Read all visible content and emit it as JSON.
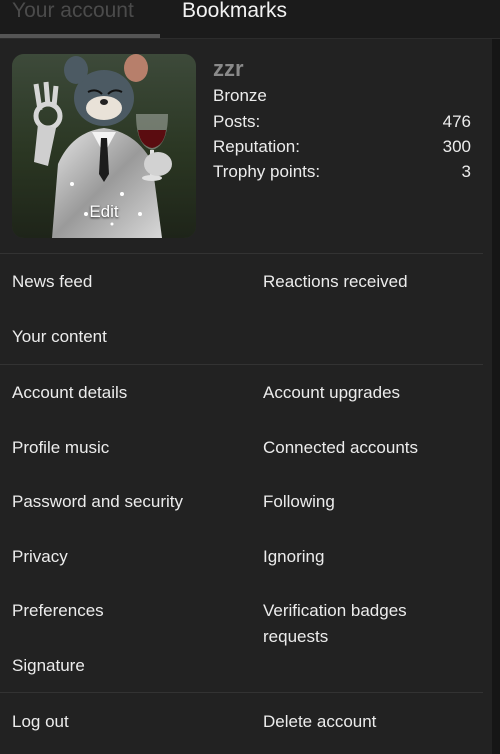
{
  "tabs": {
    "account": "Your account",
    "bookmarks": "Bookmarks"
  },
  "profile": {
    "username": "zzr",
    "rank": "Bronze",
    "edit_label": "Edit",
    "stats": [
      {
        "label": "Posts:",
        "value": "476"
      },
      {
        "label": "Reputation:",
        "value": "300"
      },
      {
        "label": "Trophy points:",
        "value": "3"
      }
    ]
  },
  "menu": {
    "news_feed": "News feed",
    "reactions_received": "Reactions received",
    "your_content": "Your content",
    "account_details": "Account details",
    "account_upgrades": "Account upgrades",
    "profile_music": "Profile music",
    "connected_accounts": "Connected accounts",
    "password_security": "Password and security",
    "following": "Following",
    "privacy": "Privacy",
    "ignoring": "Ignoring",
    "preferences": "Preferences",
    "verification_badges": "Verification badges requests",
    "signature": "Signature",
    "log_out": "Log out",
    "delete_account": "Delete account"
  },
  "colors": {
    "background": "#1b1b1b",
    "panel": "#222222",
    "text": "#ececec",
    "muted": "#8a8a8a",
    "tab_inactive": "#4b4b4b"
  }
}
